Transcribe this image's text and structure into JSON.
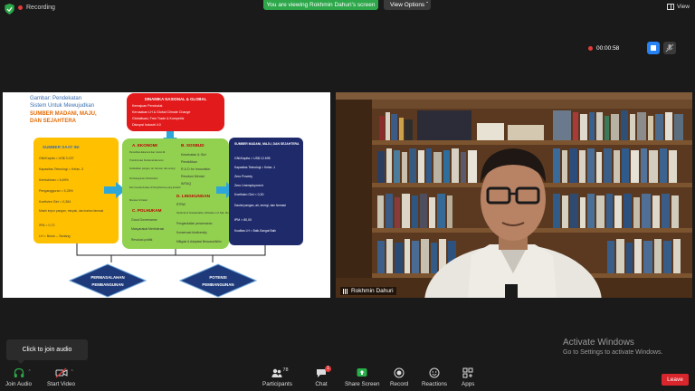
{
  "topbar": {
    "recording_label": "Recording",
    "viewing_banner": "You are viewing Rokhmin Dahuri's screen",
    "view_options": "View Options ˇ",
    "view_label": "View"
  },
  "recording_timer": "00:00:58",
  "slide": {
    "title_lines": [
      "Gambar: Pendekatan",
      "Sistem Untuk Mewujudkan"
    ],
    "title_highlight": [
      "SUMBER MADANI, MAJU,",
      "DAN SEJAHTERA"
    ],
    "dinamika": {
      "title": "DINAMIKA NASIONAL & GLOBAL",
      "items": [
        "Kemajuan Penduduk",
        "Kerusakan LH & Global Climate Change",
        "Globalisasi, Free Trade & Kompetisi",
        "Disrupsi Industri 4.0"
      ]
    },
    "sumber_saat_ini": {
      "title": "SUMBER SAAT INI",
      "items": [
        "GNI/Kapita = US$ 3.037",
        "Kapasitas Teknologi = Kelas -3",
        "Kemiskinan = 6,69%",
        "Pengangguran = 5,28%",
        "Koefisien Gini = 0,384",
        "Masih impor pangan, minyak, dan bahan farmasi",
        "IPM = 0,72",
        "LH = Buruk – Sedang"
      ]
    },
    "center": {
      "a_title": "A. EKONOMI",
      "a_items": [
        "Pemulihan Ekonomi dan Covid-19",
        "Transformasi Struktural Ekonomi",
        "Kedaulatan pangan, air, farmasi, dan energi",
        "Pembangunan Infrastruktur",
        "Iklim Investasi & Ease of Doing Business yang kondusif",
        "Moneter & Fiskal"
      ],
      "b_title": "B. SOSBUD",
      "b_items": [
        "Kesehatan & Gizi",
        "Pendidikan",
        "R & D for Innovation",
        "Revolusi Mental",
        "IMTAQ"
      ],
      "c_title": "C. POLHUKAM",
      "c_items": [
        "Good Governance",
        "Masyarakat Meritokrasi",
        "Revolusi politik"
      ],
      "d_title": "D. LINGKUNGAN",
      "d_items": [
        "RTRW",
        "Optimal & Sustainable Utilization of Nat. Res.",
        "Pengendalian pencemaran",
        "Konservasi biodiversity",
        "Mitigasi & Adaptasi Bencana/Iklim"
      ]
    },
    "sumber_target": {
      "title": "SUMBER MADANI, MAJU, DAN SEJAHTERA",
      "items": [
        "GNI/Kapita > US$ 12.695",
        "Kapasitas Teknologi = Kelas -1",
        "Zero Poverty",
        "Zero Unemployment",
        "Koefisien Gini < 0,30",
        "Daulat pangan, air, energi, dan farmasi",
        "IPM > 80,00",
        "Kualitas LH = Baik-Sangat Baik"
      ]
    },
    "permasalahan": [
      "PERMASALAHAN",
      "PEMBANGUNAN"
    ],
    "potensi": [
      "POTENSI",
      "PEMBANGUNAN"
    ]
  },
  "video": {
    "participant_name": "Rokhmin Dahuri"
  },
  "activate_windows": {
    "title": "Activate Windows",
    "subtitle": "Go to Settings to activate Windows."
  },
  "tooltip": "Click to join audio",
  "toolbar": {
    "join_audio": "Join Audio",
    "start_video": "Start Video",
    "participants": "Participants",
    "participants_count": "78",
    "chat": "Chat",
    "chat_badge": "1",
    "share_screen": "Share Screen",
    "record": "Record",
    "reactions": "Reactions",
    "apps": "Apps",
    "leave": "Leave"
  },
  "colors": {
    "green_banner": "#2da74a",
    "leave_red": "#d9262c",
    "share_green": "#27b04a",
    "stop_blue": "#2681f2"
  }
}
